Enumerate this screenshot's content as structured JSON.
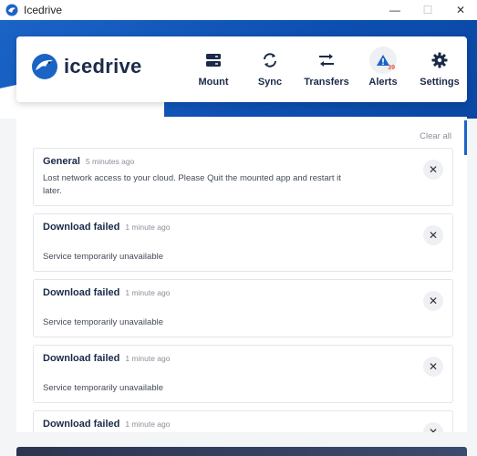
{
  "window": {
    "title": "Icedrive",
    "controls": [
      "—",
      "☐",
      "✕"
    ]
  },
  "brand": {
    "name": "icedrive",
    "accent": "#1a64c6",
    "navy": "#1b2a49"
  },
  "nav": {
    "items": [
      {
        "label": "Mount",
        "icon": "drive-icon"
      },
      {
        "label": "Sync",
        "icon": "sync-icon"
      },
      {
        "label": "Transfers",
        "icon": "transfer-arrows-icon"
      },
      {
        "label": "Alerts",
        "icon": "alert-icon",
        "count": "39"
      },
      {
        "label": "Settings",
        "icon": "gear-icon"
      }
    ]
  },
  "alerts": {
    "clear_all": "Clear all",
    "items": [
      {
        "title": "General",
        "time": "5 minutes ago",
        "message": "Lost network access to your cloud. Please Quit the mounted app and restart it later."
      },
      {
        "title": "Download failed",
        "time": "1 minute ago",
        "message": "Service temporarily unavailable"
      },
      {
        "title": "Download failed",
        "time": "1 minute ago",
        "message": "Service temporarily unavailable"
      },
      {
        "title": "Download failed",
        "time": "1 minute ago",
        "message": "Service temporarily unavailable"
      },
      {
        "title": "Download failed",
        "time": "1 minute ago",
        "message": ""
      }
    ],
    "close_glyph": "✕"
  }
}
